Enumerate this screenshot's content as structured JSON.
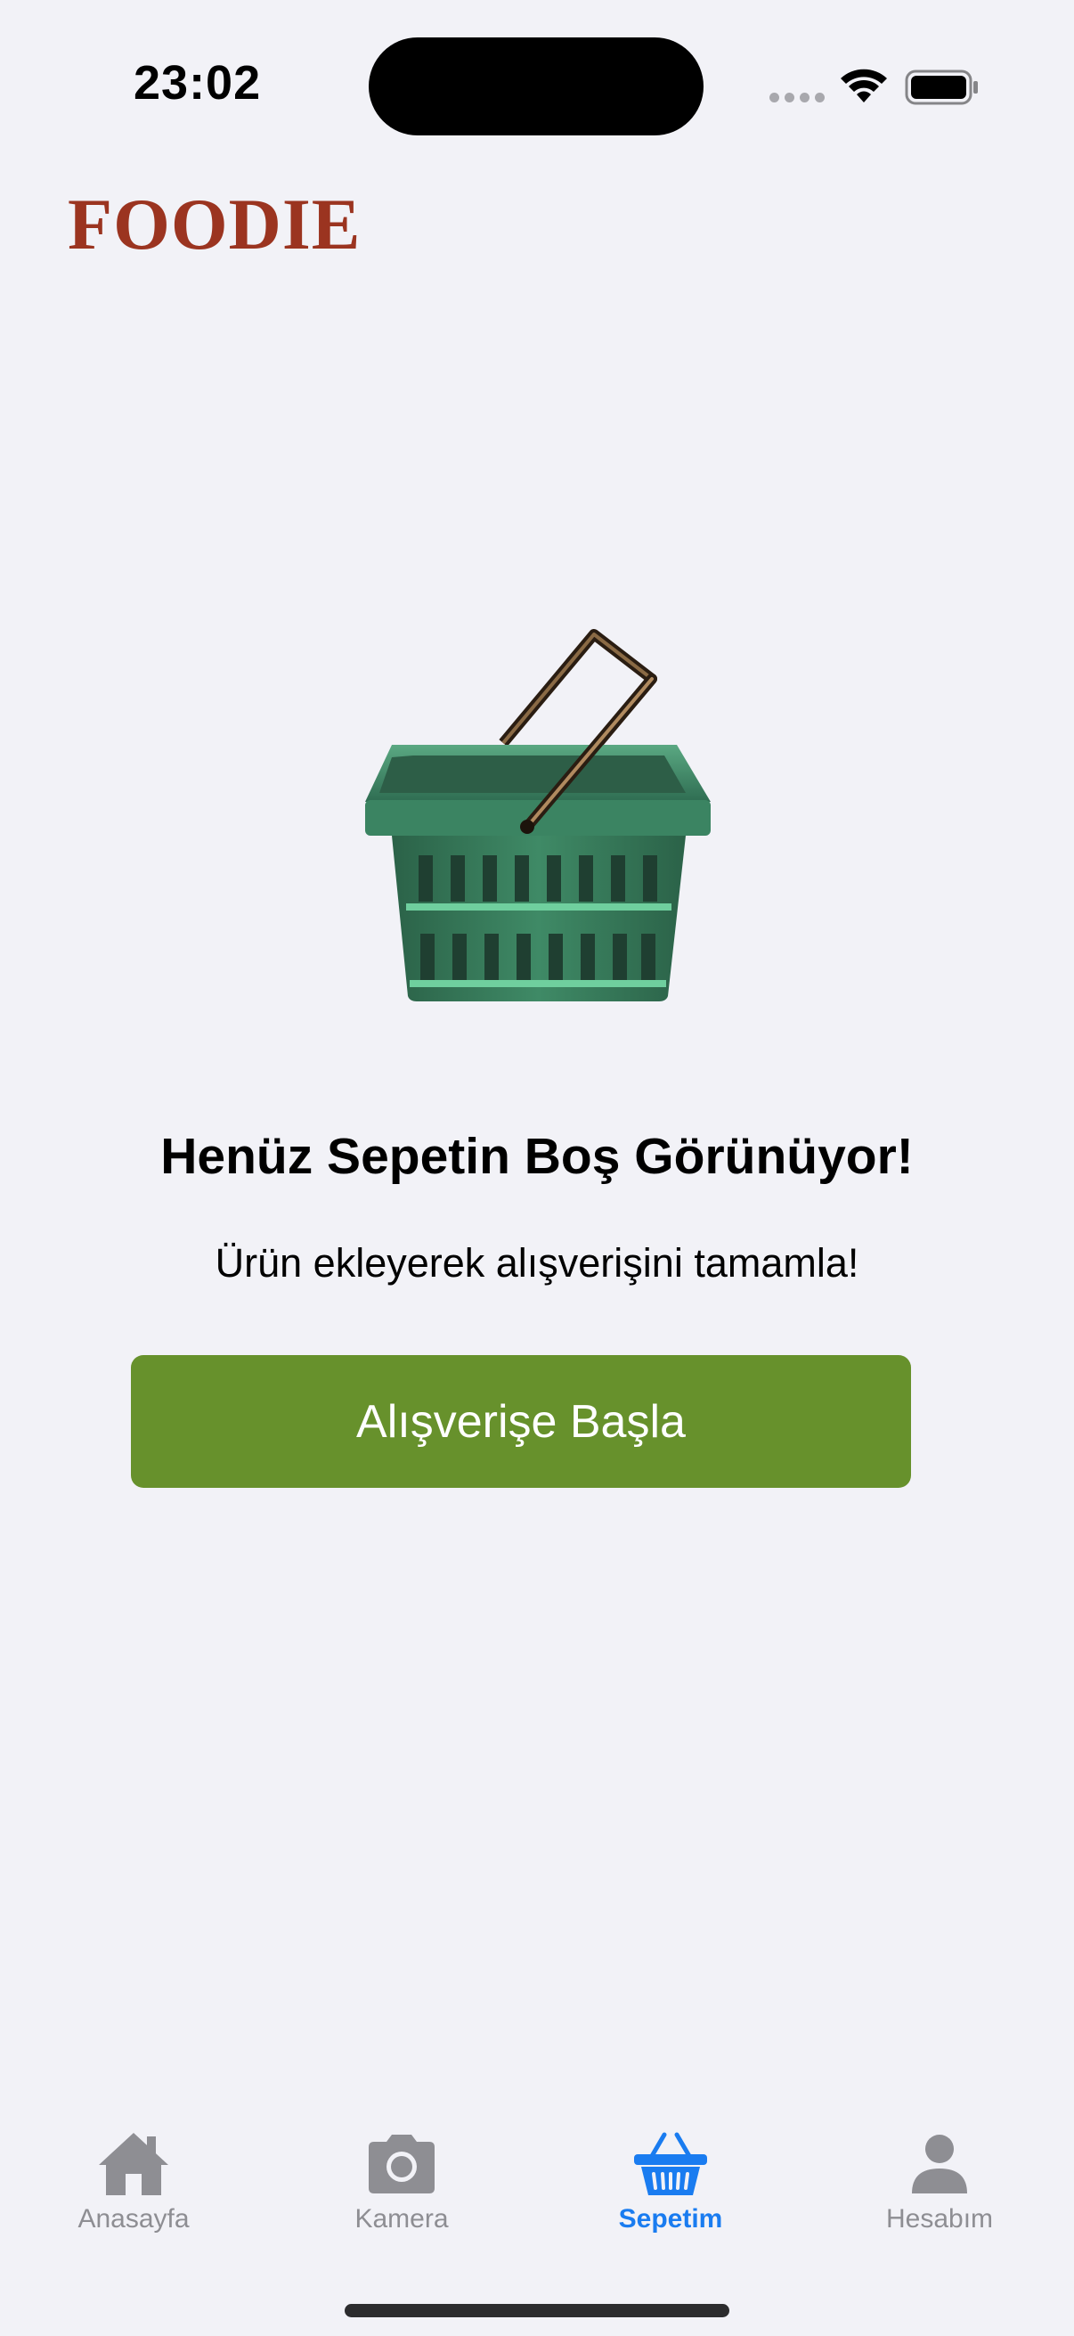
{
  "status_bar": {
    "time": "23:02",
    "icons": [
      "cellular-signal-icon",
      "wifi-icon",
      "battery-icon"
    ]
  },
  "app": {
    "brand": "FOODIE",
    "brand_color": "#9b3420"
  },
  "empty_cart": {
    "illustration": "shopping-basket-icon",
    "title": "Henüz Sepetin Boş Görünüyor!",
    "subtitle": "Ürün ekleyerek alışverişini tamamla!",
    "button_label": "Alışverişe Başla",
    "button_color": "#67912c"
  },
  "tab_bar": {
    "active_color": "#1a7cf0",
    "inactive_color": "#8e8e93",
    "tabs": [
      {
        "label": "Anasayfa",
        "icon": "home-icon",
        "active": false
      },
      {
        "label": "Kamera",
        "icon": "camera-icon",
        "active": false
      },
      {
        "label": "Sepetim",
        "icon": "basket-icon",
        "active": true
      },
      {
        "label": "Hesabım",
        "icon": "person-icon",
        "active": false
      }
    ]
  }
}
